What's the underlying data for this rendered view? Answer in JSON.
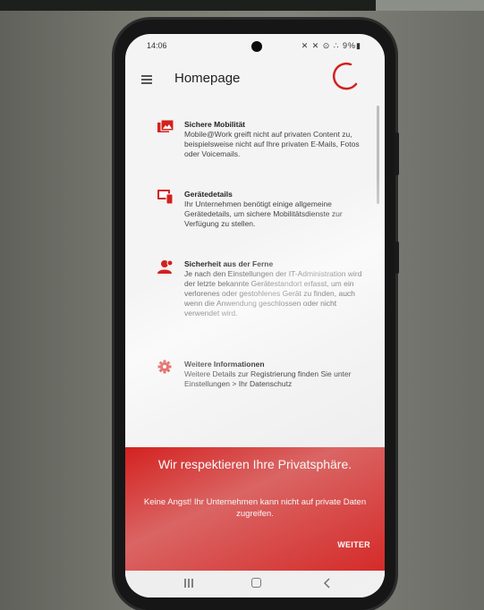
{
  "status_bar": {
    "time": "14:06",
    "icons_text": "✕ ✕ ⊙ ∴ 9%▮"
  },
  "app_bar": {
    "title": "Homepage"
  },
  "items": [
    {
      "icon": "image-icon",
      "heading": "Sichere Mobilität",
      "body": "Mobile@Work greift nicht auf privaten Content zu, beispielsweise nicht auf Ihre privaten E-Mails, Fotos oder Voicemails."
    },
    {
      "icon": "device-icon",
      "heading": "Gerätedetails",
      "body": "Ihr Unternehmen benötigt einige allgemeine Gerätedetails, um sichere Mobilitätsdienste zur Verfügung zu stellen."
    },
    {
      "icon": "remote-user-icon",
      "heading": "Sicherheit aus der Ferne",
      "body": "Je nach den Einstellungen der IT-Administration wird der letzte bekannte Gerätestandort erfasst, um ein verlorenes oder gestohlenes Gerät zu finden, auch wenn die Anwendung geschlossen oder nicht verwendet wird."
    },
    {
      "icon": "gear-icon",
      "heading": "Weitere Informationen",
      "body": "Weitere Details zur Registrierung finden Sie unter Einstellungen > Ihr Datenschutz"
    }
  ],
  "privacy_panel": {
    "headline": "Wir respektieren Ihre Privatsphäre.",
    "text": "Keine Angst! Ihr Unternehmen kann nicht auf private Daten zugreifen.",
    "button": "WEITER"
  },
  "colors": {
    "accent": "#d3201e",
    "screen_bg": "#f4f4f4"
  }
}
